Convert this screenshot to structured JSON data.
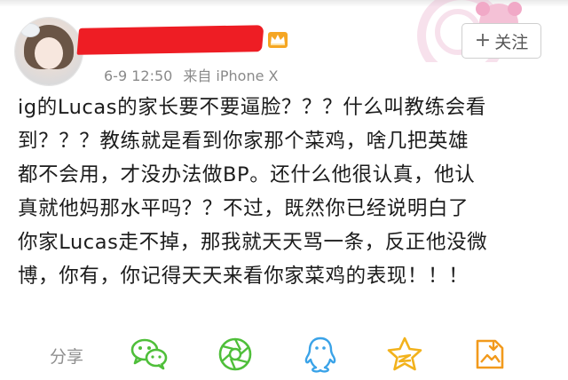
{
  "post": {
    "author": {
      "name": "",
      "avatar": "avatar"
    },
    "vip_badge_icon": "crown-icon",
    "meta": {
      "time": "6-9 12:50",
      "source": "来自 iPhone X"
    },
    "follow_button": {
      "icon": "plus-icon",
      "label": "关注"
    },
    "text_lines": [
      "ig的Lucas的家长要不要逼脸？？？什么叫教练会看",
      "到？？？教练就是看到你家那个菜鸡，啥几把英雄",
      "都不会用，才没办法做BP。还什么他很认真，他认",
      "真就他妈那水平吗？？不过，既然你已经说明白了",
      "你家Lucas走不掉，那我就天天骂一条，反正他没微",
      "博，你有，你记得天天来看你家菜鸡的表现！！！"
    ]
  },
  "share_bar": {
    "label": "分享",
    "icons": [
      "wechat-icon",
      "moments-icon",
      "qq-icon",
      "qzone-icon",
      "save-image-icon"
    ]
  },
  "colors": {
    "redaction": "#ee1d24",
    "icon_green": "#4fbf3a",
    "icon_blue": "#3aa3e8",
    "icon_yellow": "#f2b21c",
    "icon_orange": "#f29a1c",
    "meta_gray": "#8a8a8a"
  }
}
